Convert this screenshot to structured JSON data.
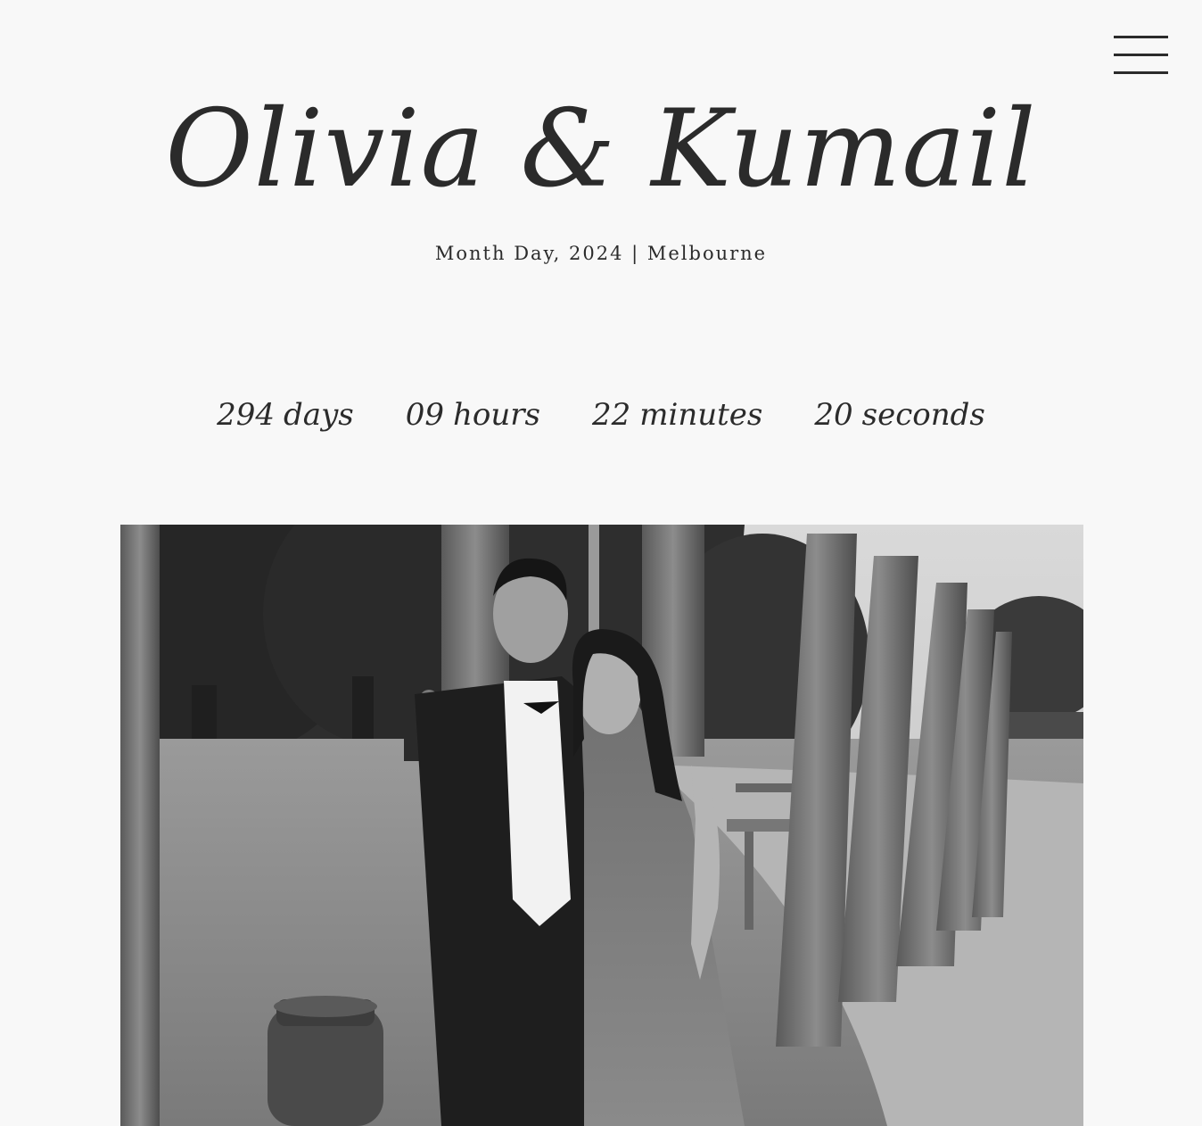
{
  "header": {
    "menu_icon": "hamburger-menu-icon"
  },
  "hero": {
    "title": "Olivia & Kumail",
    "subtitle": "Month Day, 2024 | Melbourne"
  },
  "countdown": [
    {
      "value": "294",
      "unit": "days"
    },
    {
      "value": "09",
      "unit": "hours"
    },
    {
      "value": "22",
      "unit": "minutes"
    },
    {
      "value": "20",
      "unit": "seconds"
    }
  ],
  "colors": {
    "background": "#f8f8f8",
    "text": "#2b2b2b"
  }
}
